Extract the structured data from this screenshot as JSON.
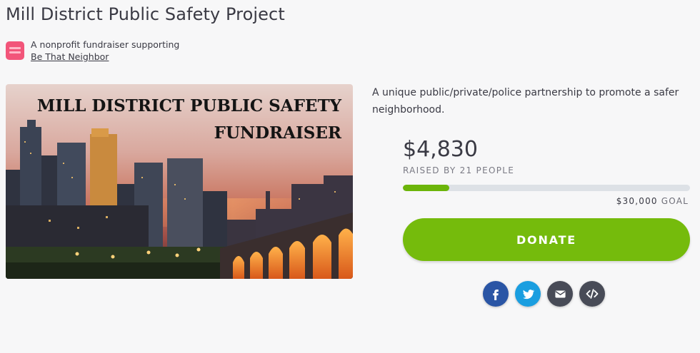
{
  "page": {
    "title": "Mill District Public Safety Project"
  },
  "organization": {
    "supporting_text": "A nonprofit fundraiser supporting",
    "name": "Be That Neighbor",
    "logo_color": "#f2557a"
  },
  "hero": {
    "headline_line1": "MILL DISTRICT PUBLIC SAFETY",
    "headline_line2": "FUNDRAISER"
  },
  "campaign": {
    "description": "A unique public/private/police partnership to promote a safer neighborhood.",
    "raised_amount": "$4,830",
    "raised_by": "RAISED BY 21 PEOPLE",
    "goal_amount": "$30,000",
    "goal_label": "GOAL",
    "progress_fraction": 0.161
  },
  "actions": {
    "donate_label": "DONATE"
  },
  "share": [
    {
      "name": "facebook-icon",
      "color": "#2a55a5"
    },
    {
      "name": "twitter-icon",
      "color": "#1a9ee0"
    },
    {
      "name": "email-icon",
      "color": "#484b57"
    },
    {
      "name": "embed-code-icon",
      "color": "#484b57"
    }
  ],
  "colors": {
    "accent": "#75bb0c",
    "progress_track": "#dde1e6"
  }
}
